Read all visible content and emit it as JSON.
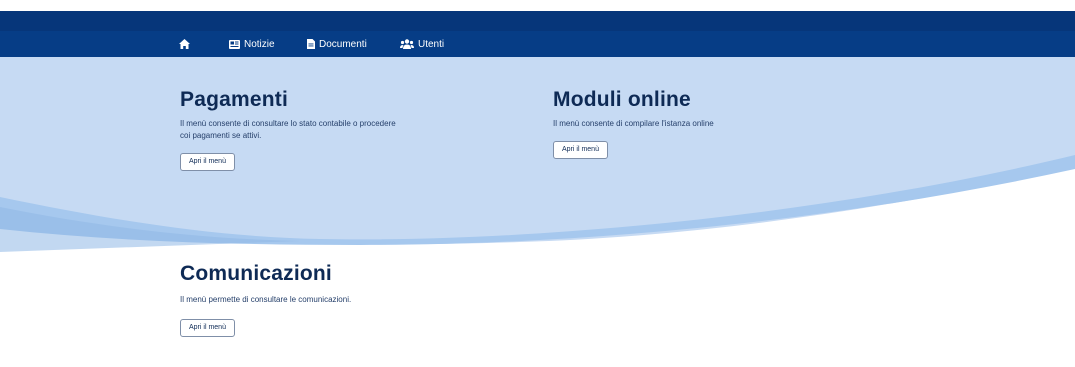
{
  "nav": {
    "items": [
      {
        "name": "nav-home",
        "icon": "home-icon",
        "label": ""
      },
      {
        "name": "nav-notizie",
        "icon": "newspaper-icon",
        "label": "Notizie"
      },
      {
        "name": "nav-documenti",
        "icon": "document-icon",
        "label": "Documenti"
      },
      {
        "name": "nav-utenti",
        "icon": "users-icon",
        "label": "Utenti"
      }
    ]
  },
  "sections": {
    "pagamenti": {
      "title": "Pagamenti",
      "description_line1": "Il menù consente di consultare lo stato contabile o procedere",
      "description_line2": "coi pagamenti se attivi.",
      "button": "Apri il menù"
    },
    "moduli": {
      "title": "Moduli online",
      "description_line1": "Il menù consente di compilare l'istanza online",
      "button": "Apri il menù"
    },
    "comunicazioni": {
      "title": "Comunicazioni",
      "description_line1": "Il menù permette di consultare le comunicazioni.",
      "button": "Apri il menù"
    }
  },
  "colors": {
    "topbar": "#06367a",
    "navbar": "#063d86",
    "hero_light": "#c9dcf4",
    "hero_wave": "#9fc3ec",
    "title": "#0e2a55"
  }
}
